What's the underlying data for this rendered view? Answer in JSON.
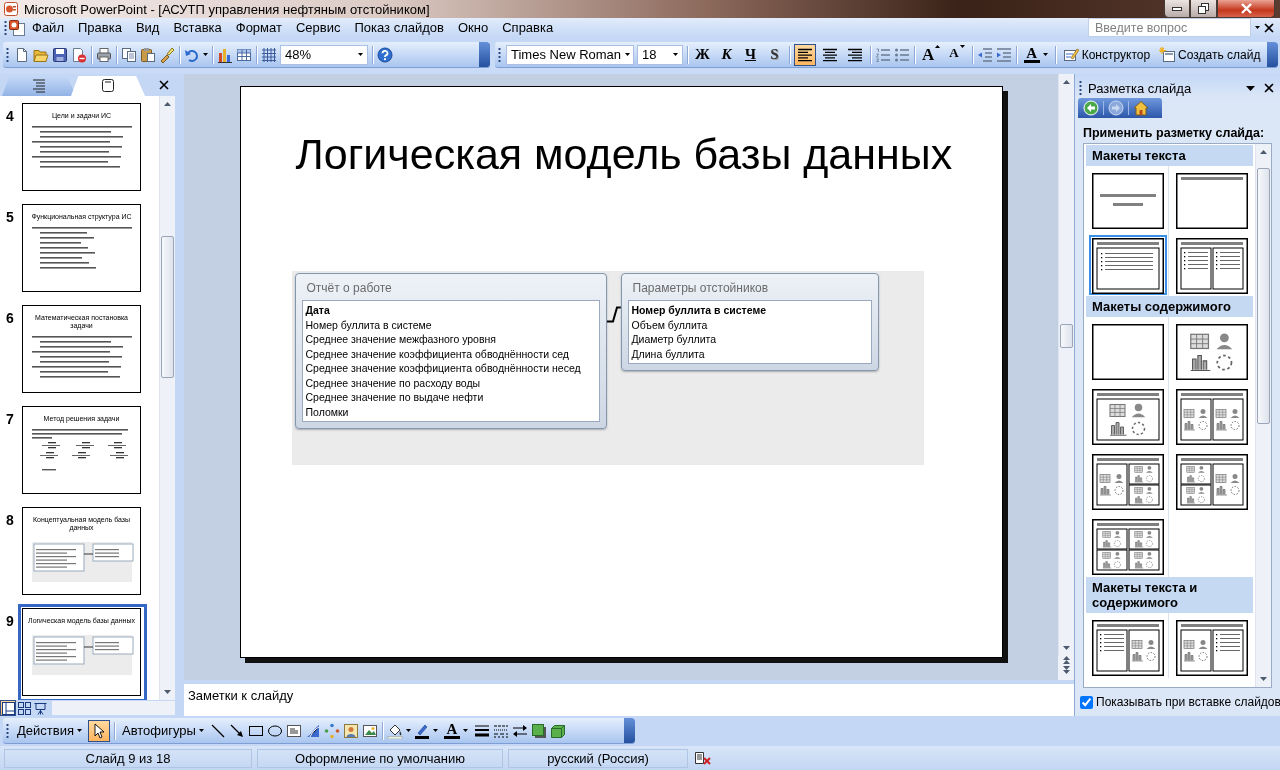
{
  "window": {
    "title": "Microsoft PowerPoint - [АСУТП управления нефтяным отстойником]"
  },
  "menu": [
    "Файл",
    "Правка",
    "Вид",
    "Вставка",
    "Формат",
    "Сервис",
    "Показ слайдов",
    "Окно",
    "Справка"
  ],
  "help_search": {
    "placeholder": "Введите вопрос"
  },
  "standard_toolbar": {
    "zoom": "48%"
  },
  "format_toolbar": {
    "font": "Times New Roman",
    "size": "18",
    "style_buttons": [
      {
        "kind": "bold",
        "label": "Ж"
      },
      {
        "kind": "italic",
        "label": "К"
      },
      {
        "kind": "underline",
        "label": "Ч"
      },
      {
        "kind": "shadow",
        "label": "S"
      }
    ],
    "align": [
      {
        "kind": "left",
        "pressed": true
      },
      {
        "kind": "center",
        "pressed": false
      },
      {
        "kind": "right",
        "pressed": false
      }
    ],
    "size_buttons": [
      {
        "kind": "grow",
        "label": "A"
      },
      {
        "kind": "shrink",
        "label": "A"
      }
    ],
    "font_color": "A",
    "designer": "Конструктор",
    "new_slide": "Создать слайд"
  },
  "outline_tabs": [
    {
      "kind": "outline",
      "selected": false
    },
    {
      "kind": "slides",
      "selected": true
    }
  ],
  "slides": [
    {
      "number": "4",
      "title": "Цели и задачи ИС",
      "kind": "text",
      "selected": false
    },
    {
      "number": "5",
      "title": "Функциональная структура ИС",
      "kind": "list",
      "selected": false
    },
    {
      "number": "6",
      "title": "Математическая постановка задачи",
      "kind": "text",
      "selected": false
    },
    {
      "number": "7",
      "title": "Метод решения задачи",
      "kind": "formulas",
      "selected": false
    },
    {
      "number": "8",
      "title": "Концептуальная модель базы данных",
      "kind": "diagram",
      "selected": false
    },
    {
      "number": "9",
      "title": "Логическая модель базы данных",
      "kind": "diagram",
      "selected": true
    }
  ],
  "view_buttons": [
    {
      "kind": "normal",
      "selected": true
    },
    {
      "kind": "sorter",
      "selected": false
    },
    {
      "kind": "show",
      "selected": false
    }
  ],
  "slide": {
    "title": "Логическая модель базы данных",
    "tables": [
      {
        "name": "Отчёт о работе",
        "fields": [
          {
            "name": "Дата",
            "key": true
          },
          {
            "name": "Номер буллита в системе",
            "key": false
          },
          {
            "name": "Среднее значение межфазного уровня",
            "key": false
          },
          {
            "name": "Среднее значение коэффициента обводнённости сед",
            "key": false
          },
          {
            "name": "Среднее значение коэффициента обводнённости несед",
            "key": false
          },
          {
            "name": "Среднее значение по расходу воды",
            "key": false
          },
          {
            "name": "Среднее значение по выдаче нефти",
            "key": false
          },
          {
            "name": "Поломки",
            "key": false
          }
        ]
      },
      {
        "name": "Параметры отстойников",
        "fields": [
          {
            "name": "Номер буллита в системе",
            "key": true
          },
          {
            "name": "Объем буллита",
            "key": false
          },
          {
            "name": "Диаметр буллита",
            "key": false
          },
          {
            "name": "Длина буллита",
            "key": false
          }
        ]
      }
    ]
  },
  "notes": {
    "text": "Заметки к слайду"
  },
  "task_pane": {
    "title": "Разметка слайда",
    "nav": [
      {
        "kind": "back",
        "disabled": false
      },
      {
        "kind": "forward",
        "disabled": true
      },
      {
        "kind": "home",
        "disabled": false
      }
    ],
    "heading": "Применить разметку слайда:",
    "sections": [
      {
        "title": "Макеты текста",
        "layouts": [
          {
            "kind": "title-slide",
            "selected": false
          },
          {
            "kind": "title-only",
            "selected": false
          },
          {
            "kind": "title-text",
            "selected": true
          },
          {
            "kind": "title-2text",
            "selected": false
          }
        ]
      },
      {
        "title": "Макеты содержимого",
        "layouts": [
          {
            "kind": "blank",
            "selected": false
          },
          {
            "kind": "content",
            "selected": false
          },
          {
            "kind": "title-content",
            "selected": false
          },
          {
            "kind": "title-2content",
            "selected": false
          },
          {
            "kind": "title-content-2",
            "selected": false
          },
          {
            "kind": "title-2-content",
            "selected": false
          },
          {
            "kind": "title-4content",
            "selected": false
          }
        ]
      },
      {
        "title": "Макеты текста и содержимого",
        "layouts": [
          {
            "kind": "title-text-content",
            "selected": false
          },
          {
            "kind": "title-content-text",
            "selected": false
          }
        ]
      }
    ],
    "show_on_insert": {
      "label": "Показывать при вставке слайдов",
      "checked": true
    }
  },
  "drawing_toolbar": {
    "actions": "Действия",
    "select_pressed": true,
    "autoshapes": "Автофигуры",
    "font_color": "A"
  },
  "status_bar": {
    "slide": "Слайд 9 из 18",
    "design": "Оформление по умолчанию",
    "language": "русский (Россия)"
  }
}
